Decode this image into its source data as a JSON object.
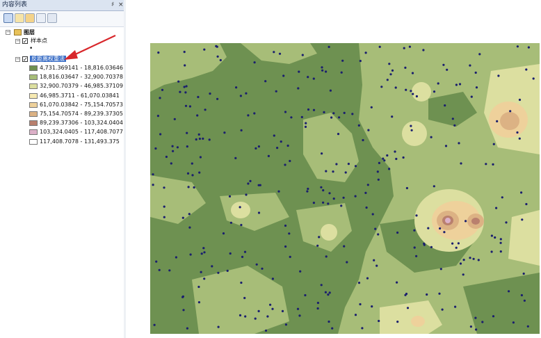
{
  "toc": {
    "title": "内容列表",
    "pin_glyph": "♯",
    "close_glyph": "×",
    "toolbar": [
      {
        "icon": "list-by-drawing-order-icon"
      },
      {
        "icon": "list-by-source-icon"
      },
      {
        "icon": "list-by-visibility-icon"
      },
      {
        "icon": "list-by-selection-icon"
      },
      {
        "icon": "options-icon"
      }
    ],
    "root_label": "图层",
    "layers": [
      {
        "label": "样本点",
        "point_symbol": "•"
      },
      {
        "label": "反距离权重法"
      }
    ],
    "classes": [
      {
        "label": "4,731.369141 - 18,816.03646",
        "color": "#6e9151"
      },
      {
        "label": "18,816.03647 - 32,900.70378",
        "color": "#a7bd78"
      },
      {
        "label": "32,900.70379 - 46,985.37109",
        "color": "#dcdfa0"
      },
      {
        "label": "46,985.3711 - 61,070.03841",
        "color": "#f7eab2"
      },
      {
        "label": "61,070.03842 - 75,154.70573",
        "color": "#eed19b"
      },
      {
        "label": "75,154.70574 - 89,239.37305",
        "color": "#dcb284"
      },
      {
        "label": "89,239.37306 - 103,324.0404",
        "color": "#b9806e"
      },
      {
        "label": "103,324.0405 - 117,408.7077",
        "color": "#dcb0c8"
      },
      {
        "label": "117,408.7078 - 131,493.375",
        "color": "#ffffff"
      }
    ]
  },
  "colors": {
    "arrow": "#d8272b",
    "point": "#1b1f6e",
    "selection": "#3a6ec6"
  }
}
